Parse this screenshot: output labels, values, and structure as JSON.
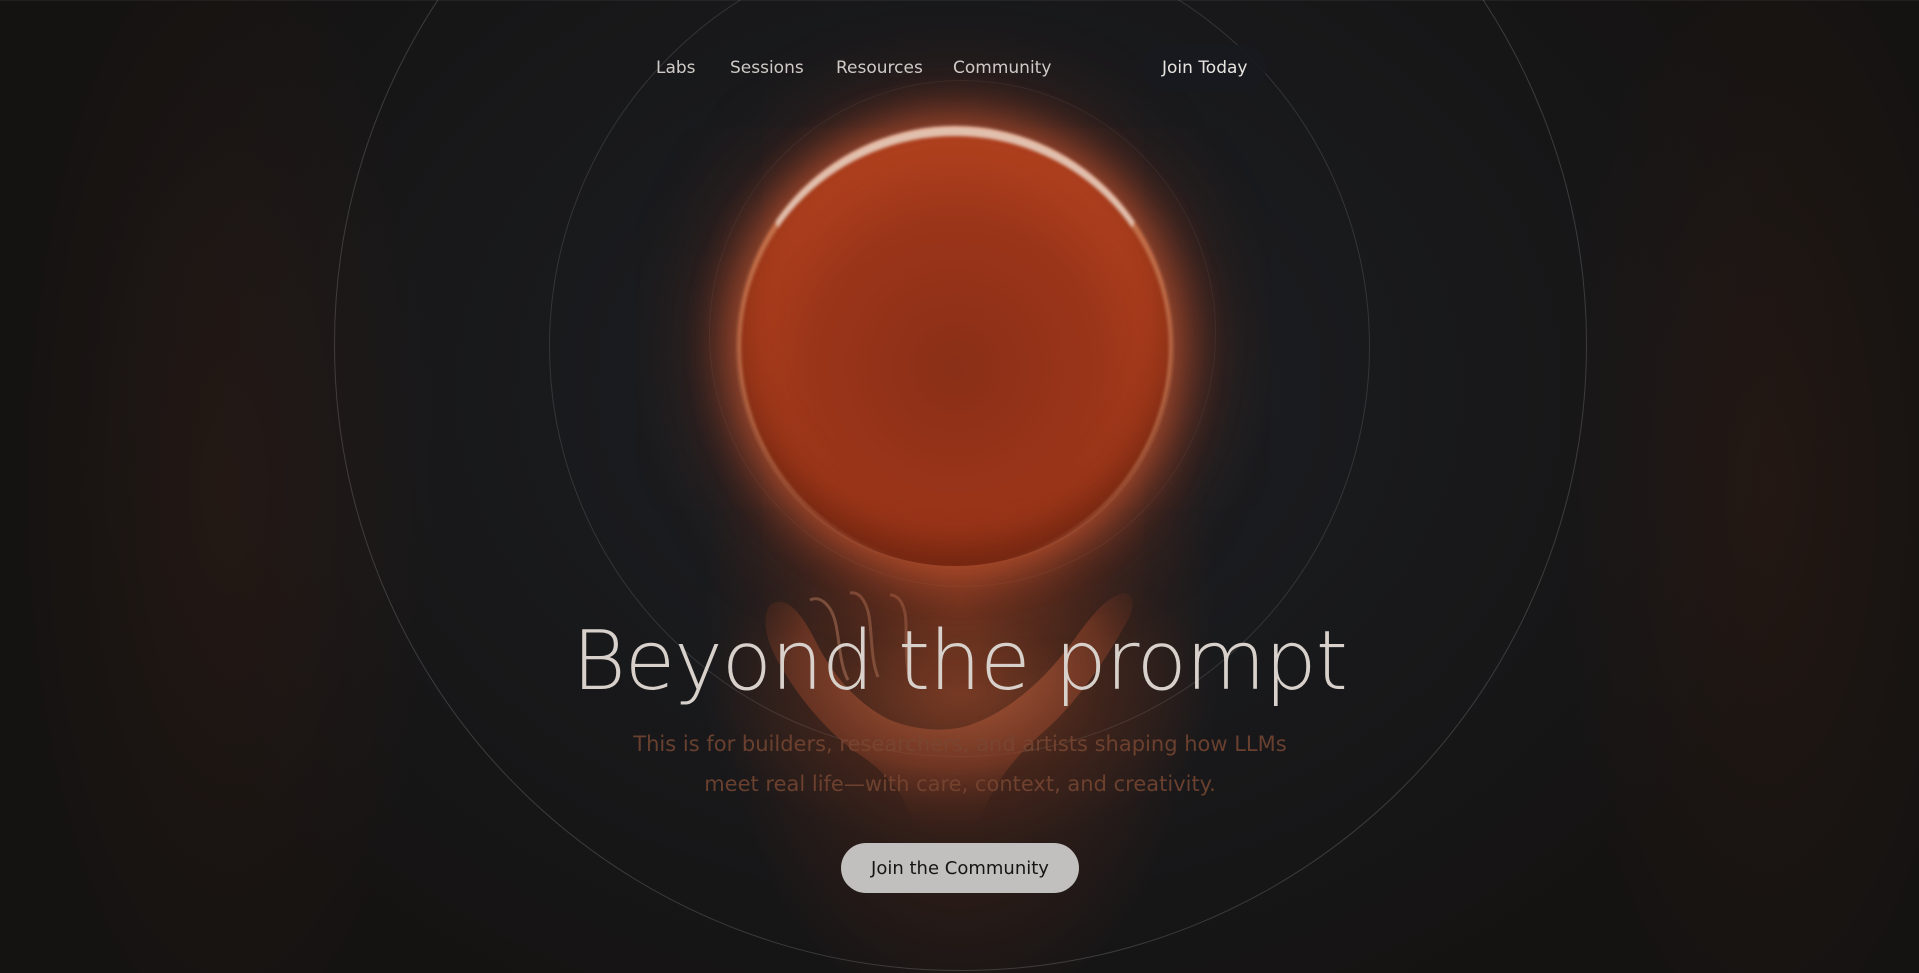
{
  "nav": {
    "links": [
      "Labs",
      "Sessions",
      "Resources",
      "Community"
    ],
    "cta_label": "Join Today"
  },
  "hero": {
    "title": "Beyond the prompt",
    "subtitle_line1": "This is for builders, researchers, and artists shaping how LLMs",
    "subtitle_line2": "meet real life—with care, context, and creativity.",
    "cta_label": "Join the Community"
  },
  "colors": {
    "background": "#161412",
    "orb": "#b5431f",
    "orb_glow": "#e88a58",
    "title_text": "#d8d0ca",
    "cta_background": "#c2c0be",
    "nav_button_background": "#181a20"
  },
  "icons": {
    "orb": "glowing-orb-illustration",
    "hand": "open-hand-illustration"
  }
}
